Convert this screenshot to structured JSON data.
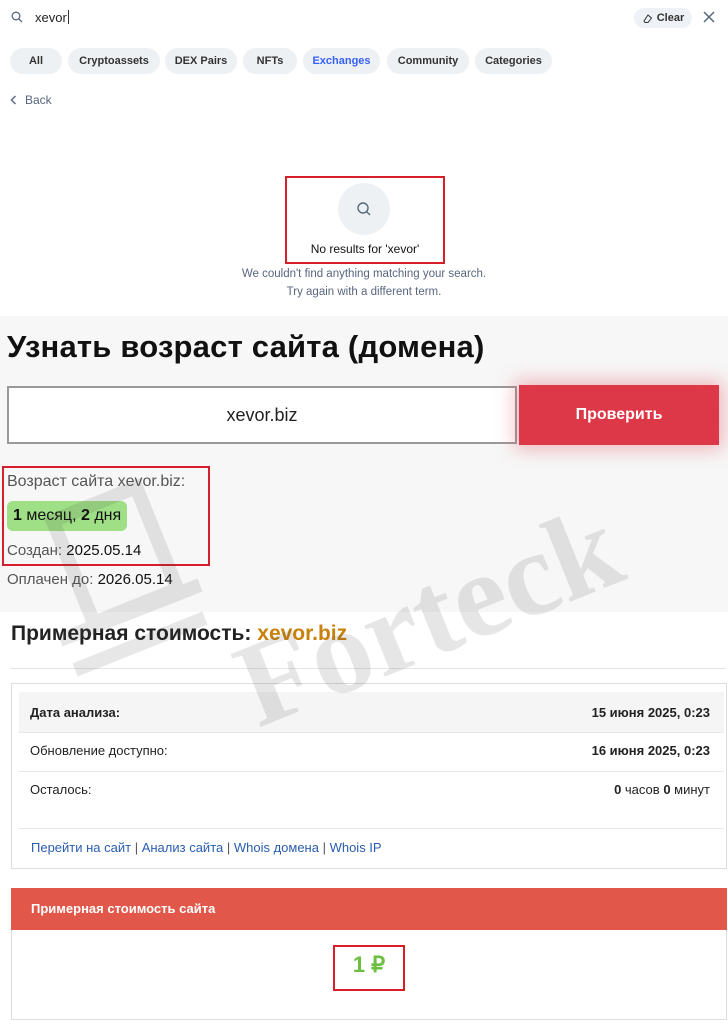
{
  "search": {
    "query": "xevor",
    "clear_label": "Clear"
  },
  "chips": [
    {
      "label": "All",
      "active": false
    },
    {
      "label": "Cryptoassets",
      "active": false
    },
    {
      "label": "DEX Pairs",
      "active": false
    },
    {
      "label": "NFTs",
      "active": false
    },
    {
      "label": "Exchanges",
      "active": true
    },
    {
      "label": "Community",
      "active": false
    },
    {
      "label": "Categories",
      "active": false
    }
  ],
  "back_label": "Back",
  "no_results": {
    "title": "No results for 'xevor'",
    "line1": "We couldn't find anything matching your search.",
    "line2": "Try again with a different term."
  },
  "age": {
    "title": "Узнать возраст сайта (домена)",
    "input_value": "xevor.biz",
    "button_label": "Проверить",
    "label": "Возраст сайта xevor.biz:",
    "months_num": "1",
    "months_word": " месяц, ",
    "days_num": "2",
    "days_word": " дня",
    "created_label": "Создан: ",
    "created_value": "2025.05.14",
    "paid_label": "Оплачен до: ",
    "paid_value": "2026.05.14"
  },
  "cost": {
    "title_prefix": "Примерная стоимость: ",
    "domain": "xevor.biz",
    "rows": [
      {
        "label": "Дата анализа:",
        "value": "15 июня 2025, 0:23"
      },
      {
        "label": "Обновление доступно:",
        "value": "16 июня 2025, 0:23"
      },
      {
        "label": "Осталось:",
        "hours": "0",
        "hours_unit": " часов ",
        "minutes": "0",
        "minutes_unit": " минут"
      }
    ],
    "links": [
      "Перейти на сайт",
      "Анализ сайта",
      "Whois домена",
      "Whois IP"
    ],
    "link_sep": " | ",
    "price_header": "Примерная стоимость сайта",
    "price_value": "1 ₽"
  },
  "watermark_text": "Forteck",
  "colors": {
    "accent_blue": "#3861fb",
    "check_button": "#dc3848",
    "price_header": "#e1584a",
    "price_value": "#6cbf3f",
    "highlight_box": "#d5202b",
    "domain_highlight": "#c8820a"
  }
}
